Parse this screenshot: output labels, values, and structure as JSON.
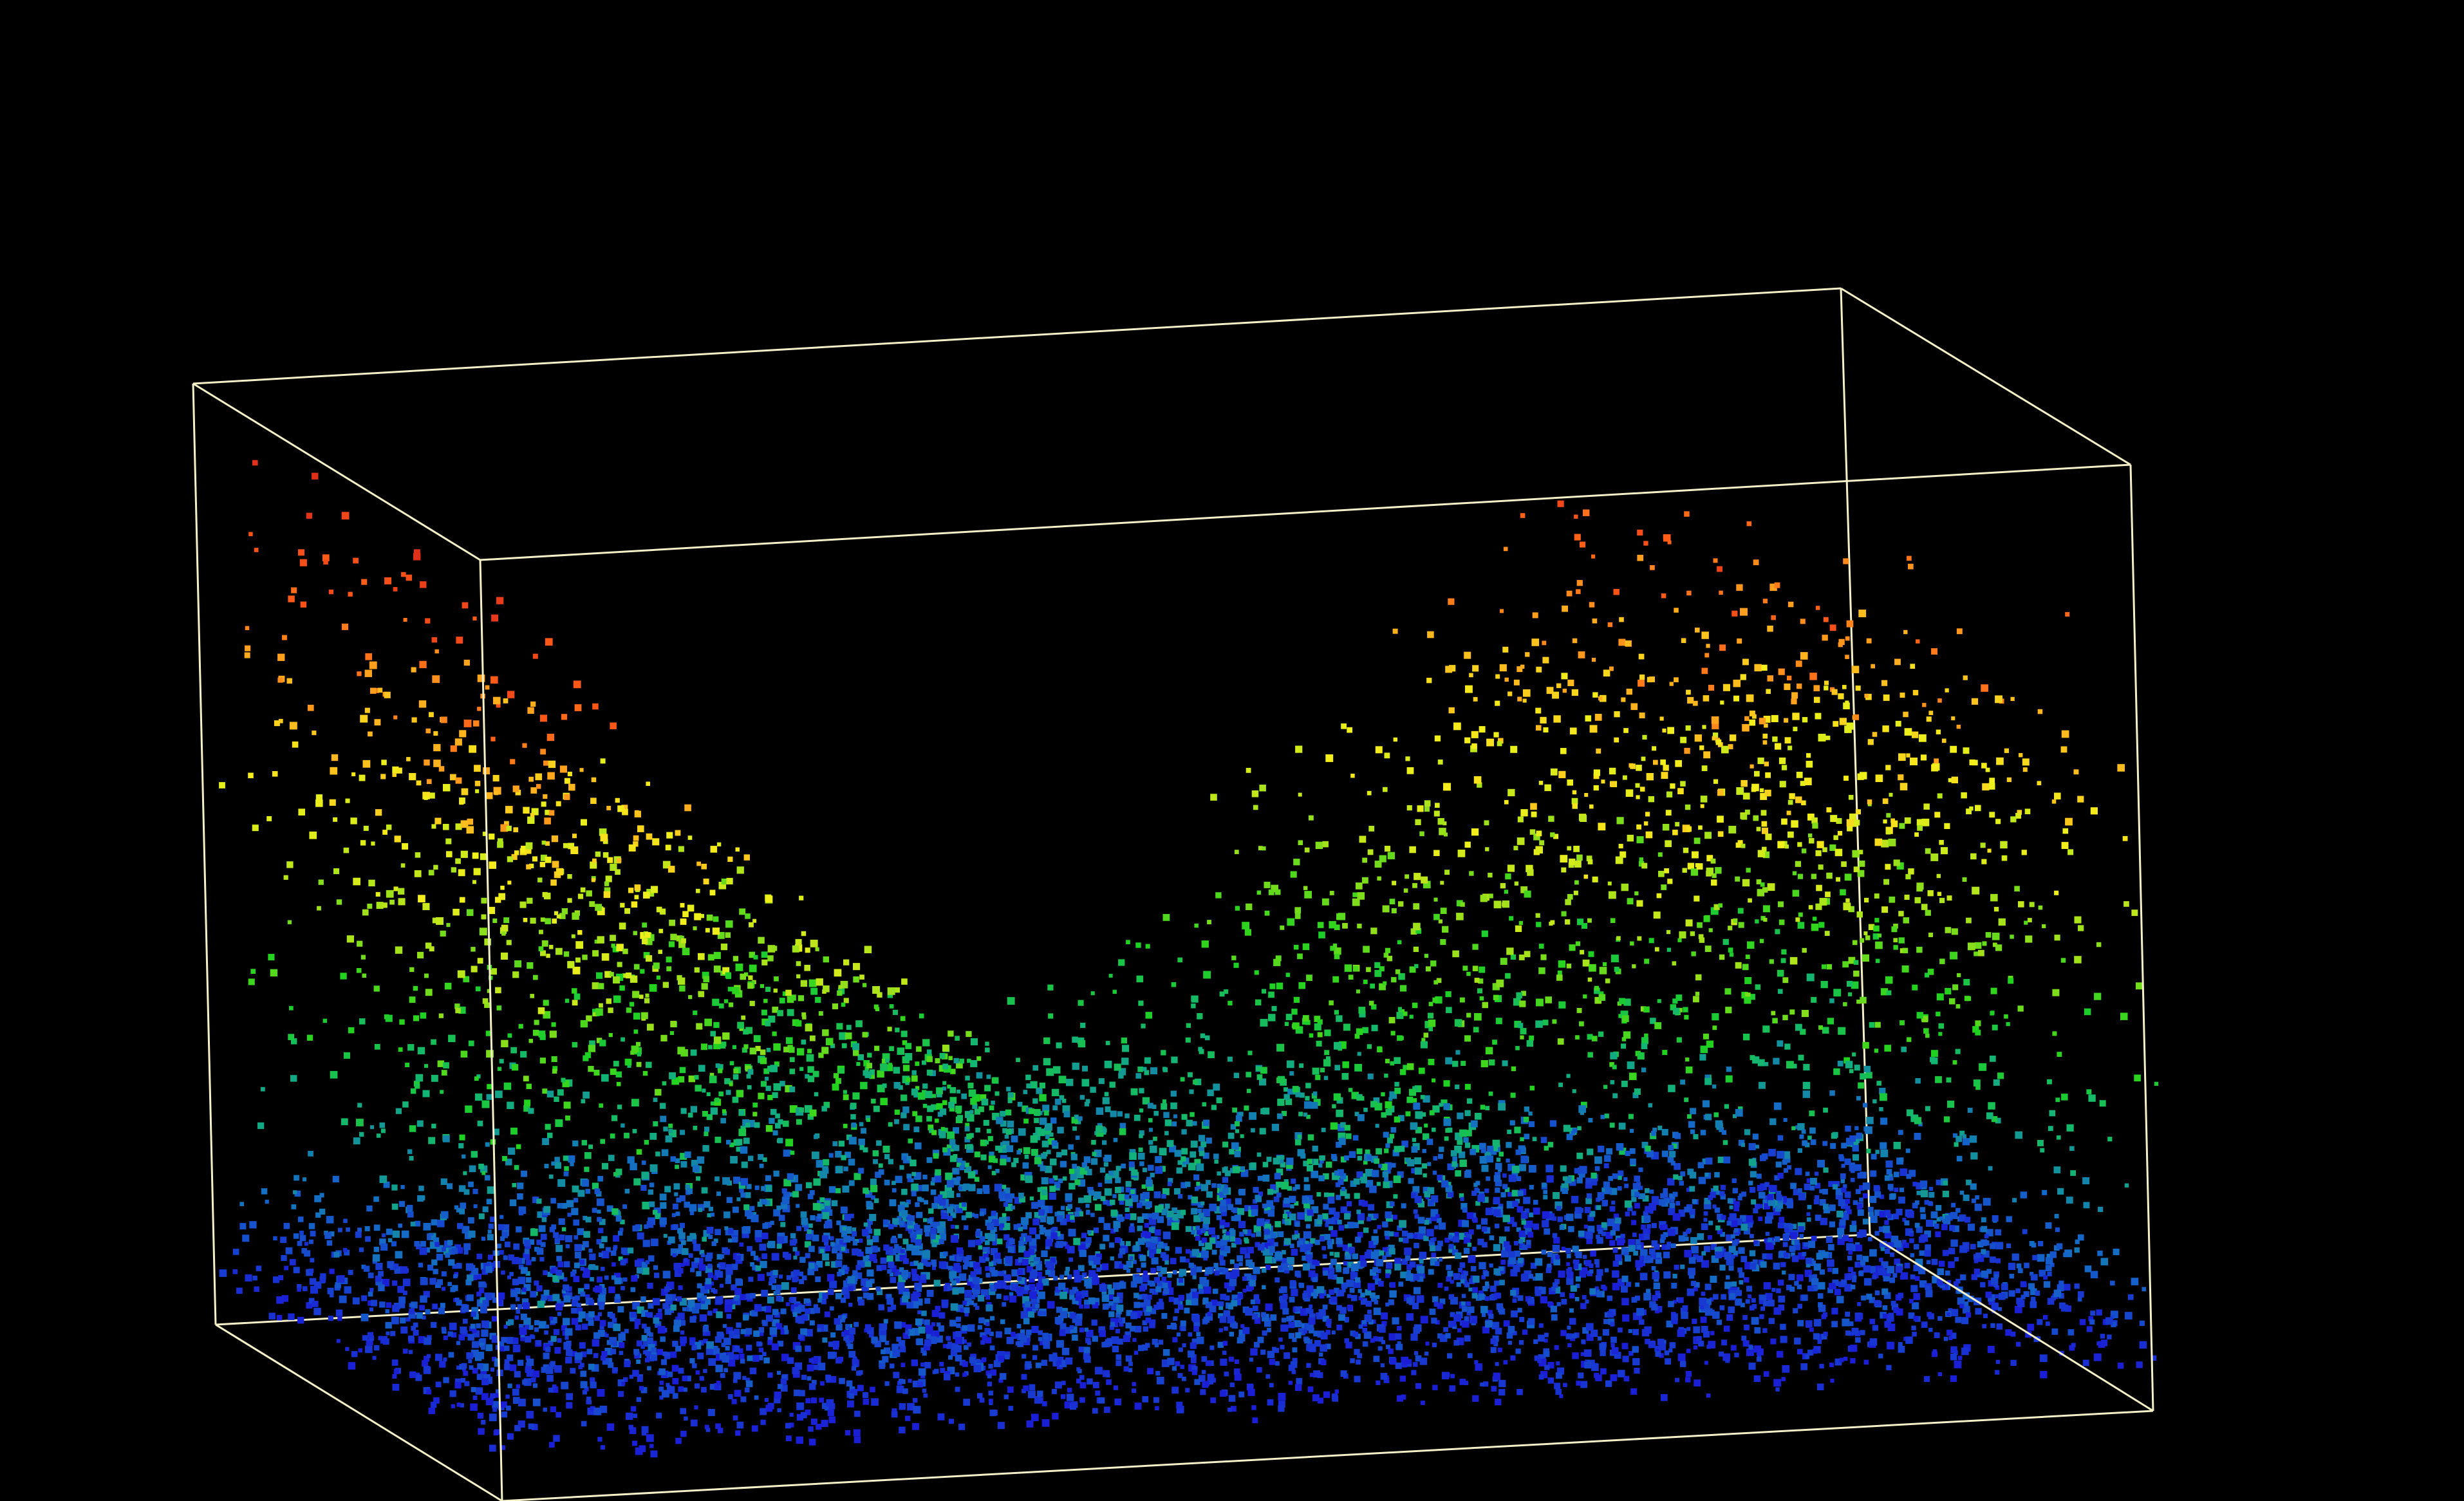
{
  "scene": {
    "background": "#000000",
    "bounding_box_color": "#f5f0c8",
    "colormap": [
      "#1a1fd6",
      "#1468c8",
      "#12b27a",
      "#1fd21f",
      "#9be01a",
      "#f3f01c",
      "#ffb01e",
      "#ff5a18",
      "#e0301a"
    ]
  }
}
